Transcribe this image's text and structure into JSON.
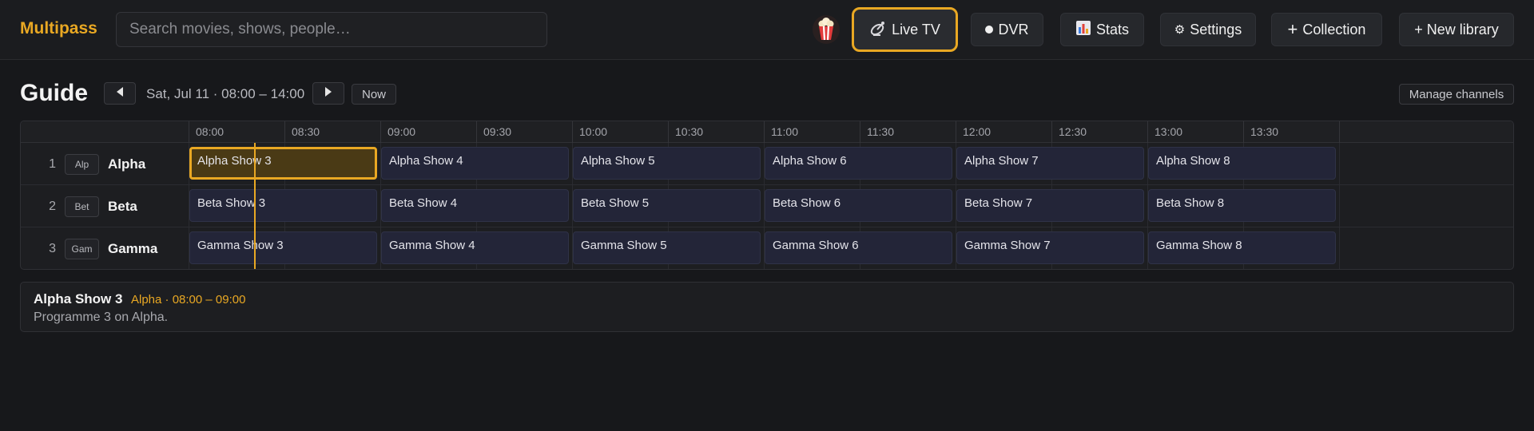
{
  "header": {
    "brand": "Multipass",
    "search_placeholder": "Search movies, shows, people…",
    "buttons": {
      "live_tv": "Live TV",
      "dvr": "DVR",
      "stats": "Stats",
      "settings": "Settings",
      "collection": "Collection",
      "new_library": "+ New library"
    }
  },
  "guide": {
    "title": "Guide",
    "range": "Sat, Jul 11 · 08:00 – 14:00",
    "now_label": "Now",
    "manage_label": "Manage channels",
    "times": [
      "08:00",
      "08:30",
      "09:00",
      "09:30",
      "10:00",
      "10:30",
      "11:00",
      "11:30",
      "12:00",
      "12:30",
      "13:00",
      "13:30"
    ],
    "channels": [
      {
        "number": "1",
        "logo": "Alp",
        "name": "Alpha",
        "programs": [
          "Alpha Show 3",
          "Alpha Show 4",
          "Alpha Show 5",
          "Alpha Show 6",
          "Alpha Show 7",
          "Alpha Show 8"
        ]
      },
      {
        "number": "2",
        "logo": "Bet",
        "name": "Beta",
        "programs": [
          "Beta Show 3",
          "Beta Show 4",
          "Beta Show 5",
          "Beta Show 6",
          "Beta Show 7",
          "Beta Show 8"
        ]
      },
      {
        "number": "3",
        "logo": "Gam",
        "name": "Gamma",
        "programs": [
          "Gamma Show 3",
          "Gamma Show 4",
          "Gamma Show 5",
          "Gamma Show 6",
          "Gamma Show 7",
          "Gamma Show 8"
        ]
      }
    ],
    "selected": {
      "channel": 0,
      "program": 0
    }
  },
  "detail": {
    "title": "Alpha Show 3",
    "meta": "Alpha · 08:00 – 09:00",
    "description": "Programme 3 on Alpha."
  },
  "colors": {
    "accent": "#e9a823",
    "background": "#17181b",
    "program": "#232538"
  }
}
